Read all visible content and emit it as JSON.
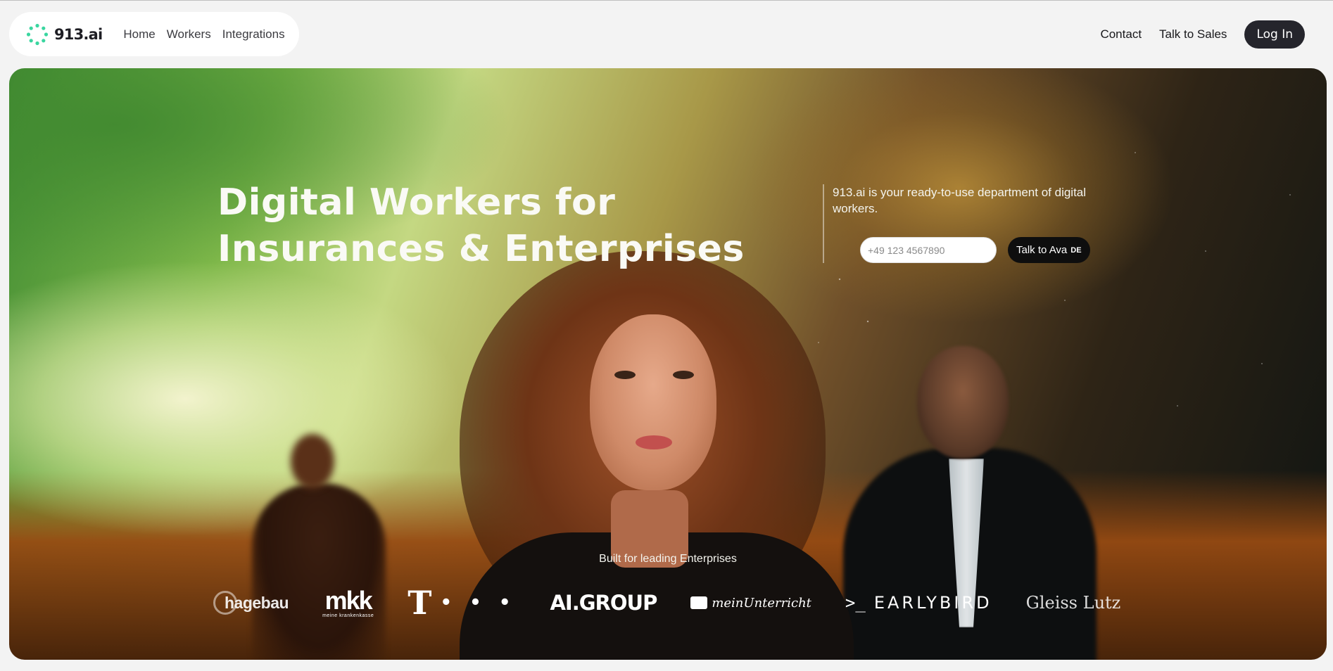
{
  "header": {
    "logo_text": "913.ai",
    "nav": [
      "Home",
      "Workers",
      "Integrations"
    ],
    "right_links": [
      "Contact",
      "Talk to Sales"
    ],
    "login_label": "Log In"
  },
  "hero": {
    "title_line1": "Digital Workers for",
    "title_line2": "Insurances & Enterprises",
    "intro": "913.ai is your ready-to-use department of digital workers.",
    "phone_placeholder": "+49 123 4567890",
    "cta_label": "Talk to Ava",
    "cta_lang": "DE",
    "built_for": "Built for leading Enterprises",
    "logos": {
      "hagebau": "hagebau",
      "mkk_big": "mkk",
      "mkk_small": "meine krankenkasse",
      "telekom_t": "T",
      "telekom_dots": "• • •",
      "aigroup": "AI.GROUP",
      "mein": "meinUnterricht",
      "earlybird_prompt": ">_",
      "earlybird": "EARLYBIRD",
      "gleiss": "Gleiss Lutz"
    }
  },
  "colors": {
    "page_bg": "#f3f3f3",
    "login_bg": "#25252c",
    "logo_accent": "#3ad6a0"
  }
}
